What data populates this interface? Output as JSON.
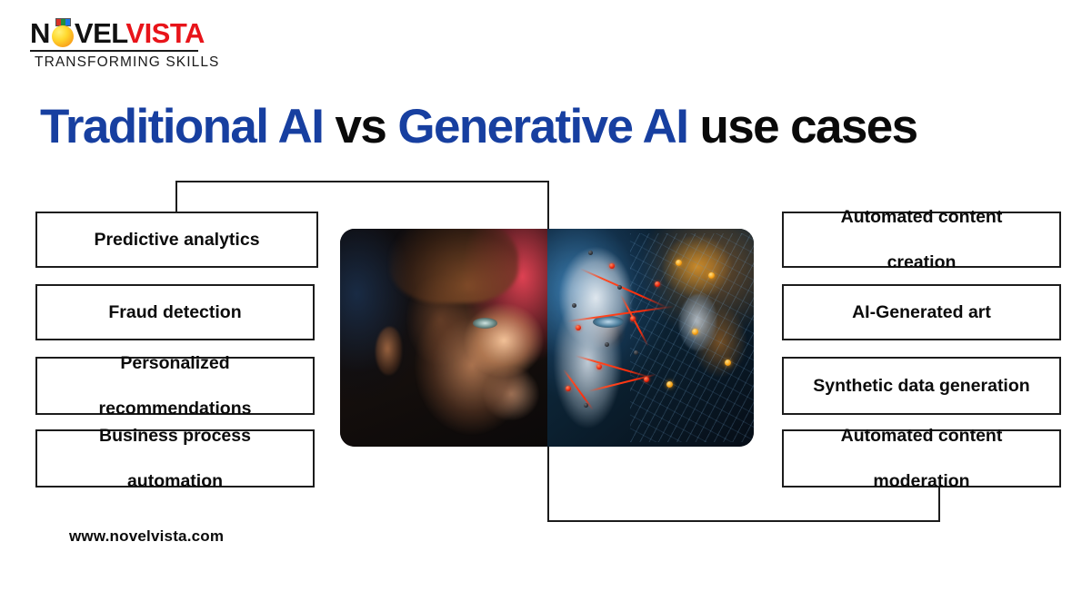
{
  "brand": {
    "logo_part1": "N",
    "logo_o": "O",
    "logo_part2": "VEL",
    "logo_part3": "VISTA",
    "tagline": "TRANSFORMING SKILLS",
    "logo_red": "#e8141a",
    "logo_black": "#111111",
    "logo_ball_color": "#ffd92e"
  },
  "title": {
    "segment1": "Traditional AI",
    "segment2": "vs",
    "segment3": "Generative AI",
    "segment4": "use cases",
    "blue": "#173fa0",
    "black": "#0a0a0a"
  },
  "left_column": {
    "heading": "Traditional AI",
    "items": [
      {
        "label": "Predictive analytics"
      },
      {
        "label": "Fraud detection"
      },
      {
        "label": "Personalized\nrecommendations",
        "line1": "Personalized",
        "line2": "recommendations"
      },
      {
        "label": "Business process\nautomation",
        "line1": "Business process",
        "line2": "automation"
      }
    ]
  },
  "right_column": {
    "heading": "Generative AI",
    "items": [
      {
        "label": "Automated content\ncreation",
        "line1": "Automated content",
        "line2": "creation"
      },
      {
        "label": "AI-Generated art"
      },
      {
        "label": "Synthetic data generation"
      },
      {
        "label": "Automated content\nmoderation",
        "line1": "Automated content",
        "line2": "moderation"
      }
    ]
  },
  "center_image": {
    "alt": "Split portrait: human face on the left facing a robotic android face on the right",
    "left_subject": "human face",
    "right_subject": "robot android face"
  },
  "footer": {
    "url": "www.novelvista.com"
  }
}
